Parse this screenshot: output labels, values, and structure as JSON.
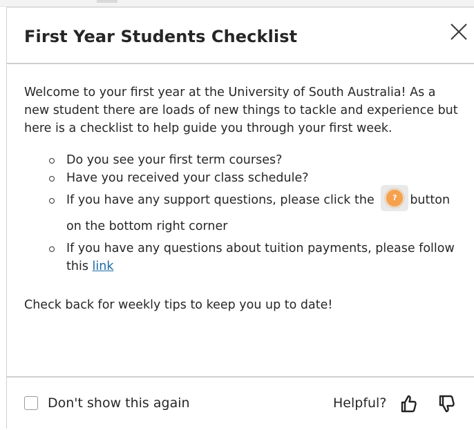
{
  "dialog": {
    "title": "First Year Students Checklist",
    "close_icon": "close-icon"
  },
  "content": {
    "intro": "Welcome to your first year at the University of South Australia! As a new student there are loads of new things to tackle and experience but here is a checklist to help guide you through your first week.",
    "items": [
      {
        "text": "Do you see your first term courses?"
      },
      {
        "text": "Have you received your class schedule?"
      },
      {
        "text_before": "If you have any support questions, please click the",
        "icon": "help-icon",
        "text_after": "button on the bottom right corner"
      },
      {
        "text_before": "If you have any questions about tuition payments, please follow this",
        "link_text": "link"
      }
    ],
    "outro": "Check back for weekly tips to keep you up to date!"
  },
  "footer": {
    "checkbox_label": "Don't show this again",
    "checkbox_checked": false,
    "helpful_label": "Helpful?",
    "thumbs_up_icon": "thumbs-up-icon",
    "thumbs_down_icon": "thumbs-down-icon"
  },
  "colors": {
    "link": "#1a6aa7",
    "help_icon": "#f5a14d",
    "divider": "#cfcfcf"
  }
}
